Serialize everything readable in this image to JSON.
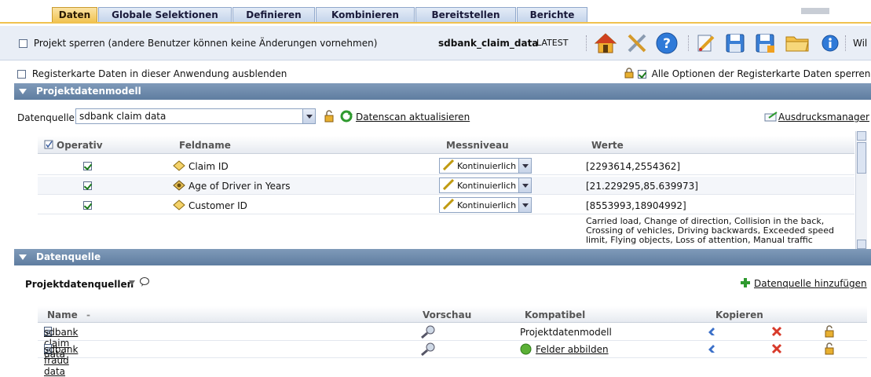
{
  "tabs": [
    "Daten",
    "Globale Selektionen",
    "Definieren",
    "Kombinieren",
    "Bereitstellen",
    "Berichte"
  ],
  "toolbar": {
    "lock_label": "Projekt sperren (andere Benutzer können keine Änderungen vornehmen)",
    "project_name": "sdbank_claim_data",
    "version": "LATEST",
    "truncated": "Wil"
  },
  "options": {
    "hide_tab_label": "Registerkarte Daten in dieser Anwendung ausblenden",
    "lock_all_label": "Alle Optionen der Registerkarte Daten sperren"
  },
  "model": {
    "section_title": "Projektdatenmodell",
    "source_label": "Datenquelle",
    "source_value": "sdbank claim data",
    "refresh_label": "Datenscan aktualisieren",
    "print_manager": "Ausdrucksmanager",
    "columns": {
      "op": "Operativ",
      "field": "Feldname",
      "measure": "Messniveau",
      "values": "Werte"
    },
    "rows": [
      {
        "field": "Claim ID",
        "measure": "Kontinuierlich",
        "values": "[2293614,2554362]"
      },
      {
        "field": "Age of Driver in Years",
        "measure": "Kontinuierlich",
        "values": "[21.229295,85.639973]"
      },
      {
        "field": "Customer ID",
        "measure": "Kontinuierlich",
        "values": "[8553993,18904992]"
      }
    ],
    "partial_values": [
      "Carried load, Change of direction, Collision in the back,",
      "Crossing of vehicles, Driving backwards, Exceeded speed",
      "limit, Flying objects, Loss of attention, Manual traffic"
    ]
  },
  "datasource": {
    "section_title": "Datenquelle",
    "subtitle": "Projektdatenquellen",
    "add_label": "Datenquelle hinzufügen",
    "columns": {
      "name": "Name",
      "sort": "-",
      "preview": "Vorschau",
      "compat": "Kompatibel",
      "copy": "Kopieren"
    },
    "rows": [
      {
        "name": "sdbank claim data",
        "compat": "Projektdatenmodell"
      },
      {
        "name": "sdbank fraud data",
        "compat": "Felder abbilden"
      }
    ]
  }
}
